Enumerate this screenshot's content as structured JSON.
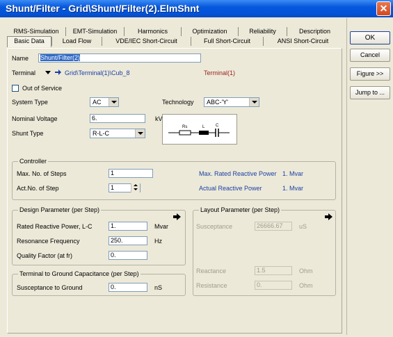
{
  "window": {
    "title": "Shunt/Filter - Grid\\Shunt/Filter(2).ElmShnt",
    "close_glyph": "✕"
  },
  "tabs": {
    "row1": [
      "RMS-Simulation",
      "EMT-Simulation",
      "Harmonics",
      "Optimization",
      "Reliability",
      "Description"
    ],
    "row2": [
      "Basic Data",
      "Load Flow",
      "VDE/IEC Short-Circuit",
      "Full Short-Circuit",
      "ANSI Short-Circuit"
    ],
    "selected": "Basic Data"
  },
  "basic": {
    "name_label": "Name",
    "name_value": "Shunt/Filter(2)",
    "terminal_label": "Terminal",
    "terminal_path": "Grid\\Terminal(1)\\Cub_8",
    "terminal_name": "Terminal(1)",
    "out_of_service_label": "Out of Service",
    "system_type_label": "System Type",
    "system_type_value": "AC",
    "technology_label": "Technology",
    "technology_value": "ABC-'Y'",
    "nominal_voltage_label": "Nominal Voltage",
    "nominal_voltage_value": "6.",
    "nominal_voltage_unit": "kV",
    "shunt_type_label": "Shunt Type",
    "shunt_type_value": "R-L-C"
  },
  "diagram": {
    "rs": "Rs",
    "l": "L",
    "c": "C"
  },
  "controller": {
    "title": "Controller",
    "max_steps_label": "Max. No. of Steps",
    "max_steps_value": "1",
    "act_step_label": "Act.No. of Step",
    "act_step_value": "1",
    "max_rated_label": "Max. Rated Reactive Power",
    "max_rated_value": "1. Mvar",
    "actual_label": "Actual Reactive Power",
    "actual_value": "1. Mvar"
  },
  "design": {
    "title": "Design Parameter (per Step)",
    "rated_label": "Rated Reactive Power, L-C",
    "rated_value": "1.",
    "rated_unit": "Mvar",
    "resonance_label": "Resonance Frequency",
    "resonance_value": "250.",
    "resonance_unit": "Hz",
    "quality_label": "Quality Factor (at fr)",
    "quality_value": "0."
  },
  "capacitance": {
    "title": "Terminal to Ground Capacitance (per Step)",
    "susceptance_label": "Susceptance to Ground",
    "susceptance_value": "0.",
    "susceptance_unit": "nS"
  },
  "layout": {
    "title": "Layout Parameter (per Step)",
    "susceptance_label": "Susceptance",
    "susceptance_value": "26666.67",
    "susceptance_unit": "uS",
    "reactance_label": "Reactance",
    "reactance_value": "1.5",
    "reactance_unit": "Ohm",
    "resistance_label": "Resistance",
    "resistance_value": "0.",
    "resistance_unit": "Ohm"
  },
  "buttons": {
    "ok": "OK",
    "cancel": "Cancel",
    "figure": "Figure >>",
    "jump": "Jump to ..."
  }
}
